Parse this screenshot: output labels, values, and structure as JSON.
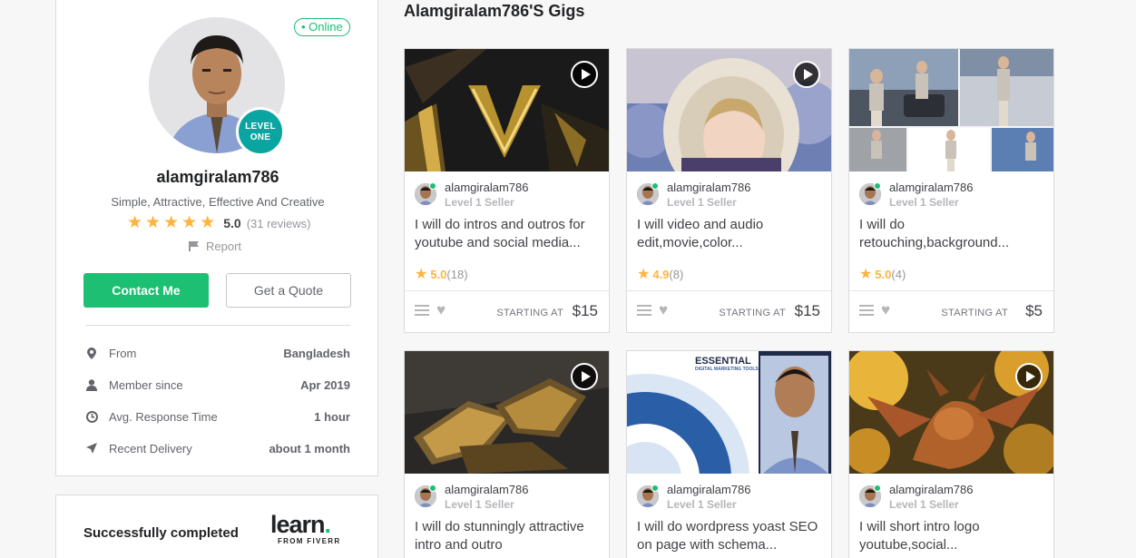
{
  "profile": {
    "status": "Online",
    "level_badge_line1": "LEVEL",
    "level_badge_line2": "ONE",
    "username": "alamgiralam786",
    "tagline": "Simple, Attractive, Effective And Creative",
    "rating": "5.0",
    "reviews": "(31 reviews)",
    "report": "Report",
    "contact_label": "Contact Me",
    "quote_label": "Get a Quote",
    "info": [
      {
        "icon": "location-pin-icon",
        "label": "From",
        "value": "Bangladesh"
      },
      {
        "icon": "user-icon",
        "label": "Member since",
        "value": "Apr 2019"
      },
      {
        "icon": "clock-icon",
        "label": "Avg. Response Time",
        "value": "1 hour"
      },
      {
        "icon": "paper-plane-icon",
        "label": "Recent Delivery",
        "value": "about 1 month"
      }
    ]
  },
  "learn": {
    "text": "Successfully completed",
    "logo_word": "learn",
    "logo_dot": ".",
    "logo_sub": "FROM FIVERR"
  },
  "gigs_title": "Alamgiralam786'S Gigs",
  "gigs": [
    {
      "seller": "alamgiralam786",
      "level": "Level 1 Seller",
      "title": "I will do intros and outros for youtube and social media...",
      "rating": "5.0",
      "count": "(18)",
      "starting_at": "STARTING AT",
      "price": "$15",
      "has_video": true
    },
    {
      "seller": "alamgiralam786",
      "level": "Level 1 Seller",
      "title": "I will video and audio edit,movie,color...",
      "rating": "4.9",
      "count": "(8)",
      "starting_at": "STARTING AT",
      "price": "$15",
      "has_video": true
    },
    {
      "seller": "alamgiralam786",
      "level": "Level 1 Seller",
      "title": "I will do retouching,background...",
      "rating": "5.0",
      "count": "(4)",
      "starting_at": "STARTING AT",
      "price": "$5",
      "has_video": false
    },
    {
      "seller": "alamgiralam786",
      "level": "Level 1 Seller",
      "title": "I will do stunningly attractive intro and outro",
      "has_video": true
    },
    {
      "seller": "alamgiralam786",
      "level": "Level 1 Seller",
      "title": "I will do wordpress yoast SEO on page with schema...",
      "image_heading": "ESSENTIAL",
      "image_subheading": "DIGITAL MARKETING TOOLS",
      "has_video": false
    },
    {
      "seller": "alamgiralam786",
      "level": "Level 1 Seller",
      "title": "I will short intro logo youtube,social...",
      "has_video": true
    }
  ],
  "colors": {
    "accent": "#1dbf73",
    "star": "#ffb33e",
    "level_badge": "#0aa5a1"
  }
}
